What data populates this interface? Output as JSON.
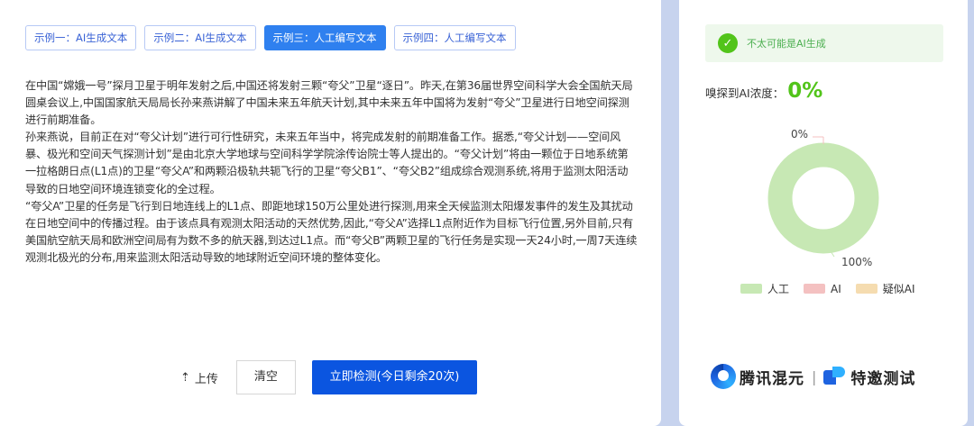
{
  "tabs": [
    {
      "label": "示例一：AI生成文本",
      "active": false
    },
    {
      "label": "示例二：AI生成文本",
      "active": false
    },
    {
      "label": "示例三：人工编写文本",
      "active": true
    },
    {
      "label": "示例四：人工编写文本",
      "active": false
    }
  ],
  "article": {
    "paragraphs": [
      "在中国“嫦娥一号”探月卫星于明年发射之后,中国还将发射三颗“夸父”卫星“逐日”。昨天,在第36届世界空间科学大会全国航天局圆桌会议上,中国国家航天局局长孙来燕讲解了中国未来五年航天计划,其中未来五年中国将为发射“夸父”卫星进行日地空间探测进行前期准备。",
      "孙来燕说，目前正在对“夸父计划”进行可行性研究，未来五年当中，将完成发射的前期准备工作。据悉,“夸父计划——空间风暴、极光和空间天气探测计划”是由北京大学地球与空间科学学院涂传诒院士等人提出的。“夸父计划”将由一颗位于日地系统第一拉格朗日点(L1点)的卫星“夸父A”和两颗沿极轨共轭飞行的卫星“夸父B1”、“夸父B2”组成综合观测系统,将用于监测太阳活动导致的日地空间环境连锁变化的全过程。",
      "“夸父A”卫星的任务是飞行到日地连线上的L1点、即距地球150万公里处进行探测,用来全天候监测太阳爆发事件的发生及其扰动在日地空间中的传播过程。由于该点具有观测太阳活动的天然优势,因此,“夸父A”选择L1点附近作为目标飞行位置,另外目前,只有美国航空航天局和欧洲空间局有为数不多的航天器,到达过L1点。而“夸父B”两颗卫星的飞行任务是实现一天24小时,一周7天连续观测北极光的分布,用来监测太阳活动导致的地球附近空间环境的整体变化。"
    ]
  },
  "actions": {
    "upload_icon": "upload-arrow-icon",
    "upload_glyph": "⇡",
    "upload_label": "上传",
    "clear_label": "清空",
    "detect_label": "立即检测(今日剩余20次)"
  },
  "result": {
    "verdict_icon": "check-circle-icon",
    "verdict": "不太可能是AI生成",
    "concentration_label": "嗅探到AI浓度：",
    "concentration_value": "0%",
    "top_label": "0%",
    "bottom_label": "100%",
    "legend": [
      {
        "label": "人工",
        "color": "#c7e8b4"
      },
      {
        "label": "AI",
        "color": "#f4c1c1"
      },
      {
        "label": "疑似AI",
        "color": "#f5dcb0"
      }
    ]
  },
  "chart_data": {
    "type": "pie",
    "categories": [
      "人工",
      "AI",
      "疑似AI"
    ],
    "values": [
      100,
      0,
      0
    ],
    "data_labels": [
      "100%",
      "0%"
    ],
    "legend": "bottom"
  },
  "colors": {
    "accent": "#2f80ef",
    "primary_button": "#0b55e0",
    "success": "#52c41a",
    "background": "#c7d3ee"
  },
  "brand": {
    "name1": "腾讯混元",
    "separator": "|",
    "name2": "特邀测试"
  }
}
